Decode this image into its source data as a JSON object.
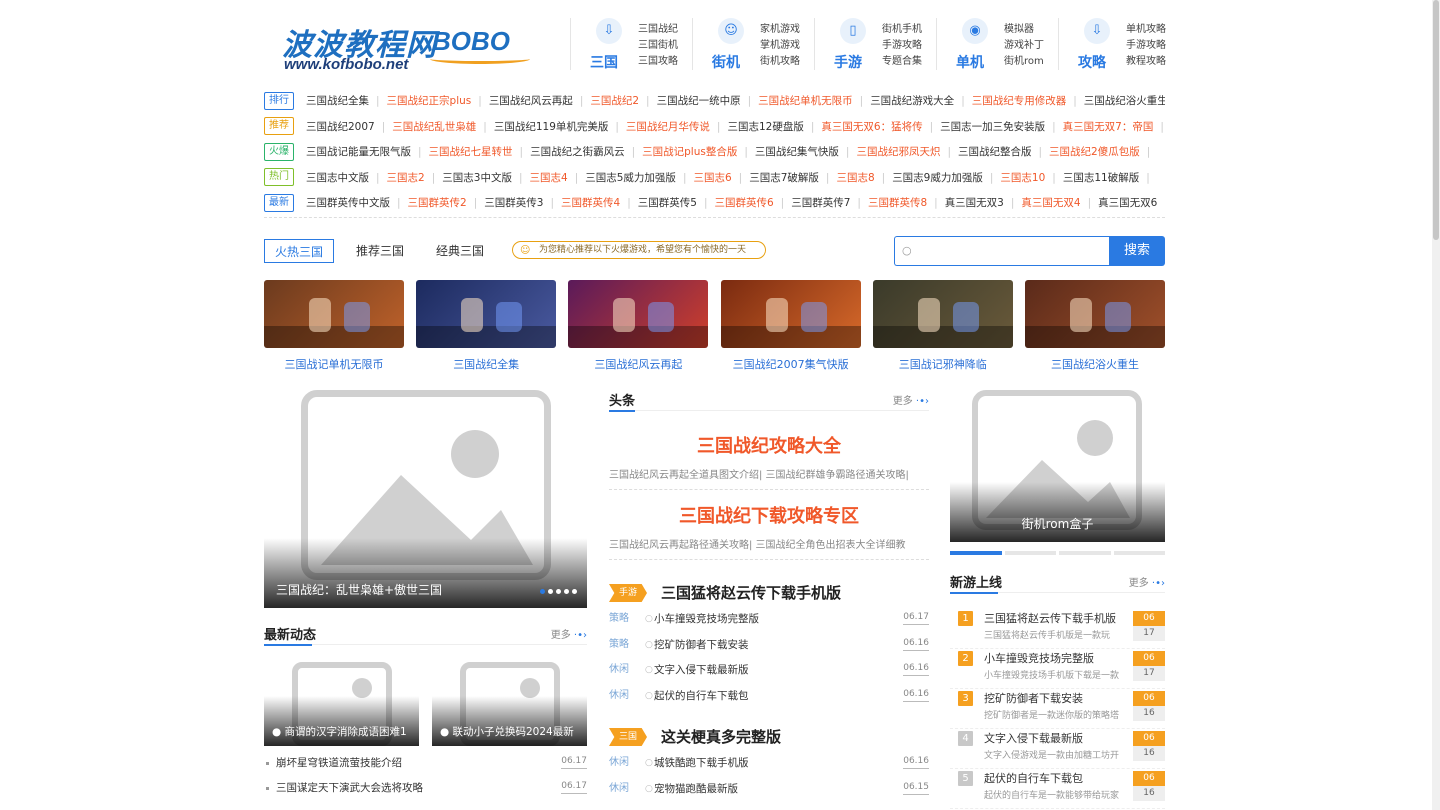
{
  "logo": {
    "cn": "波波教程网",
    "en": "BOBO",
    "url": "www.kofbobo.net"
  },
  "nav": [
    {
      "big": "三国",
      "icon": "download-icon",
      "subs": [
        "三国战纪",
        "三国街机",
        "三国攻略"
      ]
    },
    {
      "big": "街机",
      "icon": "user-icon",
      "subs": [
        "家机游戏",
        "掌机游戏",
        "街机攻略"
      ]
    },
    {
      "big": "手游",
      "icon": "phone-icon",
      "subs": [
        "街机手机",
        "手游攻略",
        "专题合集"
      ]
    },
    {
      "big": "单机",
      "icon": "gamepad-icon",
      "subs": [
        "模拟器",
        "游戏补丁",
        "街机rom"
      ]
    },
    {
      "big": "攻略",
      "icon": "download-icon",
      "subs": [
        "单机攻略",
        "手游攻略",
        "教程攻略"
      ]
    }
  ],
  "tag_rows": [
    {
      "badge": "排行",
      "items": [
        {
          "t": "三国战纪全集",
          "hot": false
        },
        {
          "t": "三国战纪正宗plus",
          "hot": true
        },
        {
          "t": "三国战纪风云再起",
          "hot": false
        },
        {
          "t": "三国战纪2",
          "hot": true
        },
        {
          "t": "三国战纪一统中原",
          "hot": false
        },
        {
          "t": "三国战纪单机无限币",
          "hot": true
        },
        {
          "t": "三国战纪游戏大全",
          "hot": false
        },
        {
          "t": "三国战纪专用修改器",
          "hot": true
        },
        {
          "t": "三国战纪浴火重生",
          "hot": false
        }
      ]
    },
    {
      "badge": "推荐",
      "items": [
        {
          "t": "三国战纪2007",
          "hot": false
        },
        {
          "t": "三国战纪乱世枭雄",
          "hot": true
        },
        {
          "t": "三国战纪119单机完美版",
          "hot": false
        },
        {
          "t": "三国战纪月华传说",
          "hot": true
        },
        {
          "t": "三国志12硬盘版",
          "hot": false
        },
        {
          "t": "真三国无双6：猛将传",
          "hot": true
        },
        {
          "t": "三国志一加三免安装版",
          "hot": false
        },
        {
          "t": "真三国无双7：帝国",
          "hot": true
        }
      ]
    },
    {
      "badge": "火爆",
      "items": [
        {
          "t": "三国战记能量无限气版",
          "hot": false
        },
        {
          "t": "三国战纪七星转世",
          "hot": true
        },
        {
          "t": "三国战纪之街霸风云",
          "hot": false
        },
        {
          "t": "三国战记plus整合版",
          "hot": true
        },
        {
          "t": "三国战纪集气快版",
          "hot": false
        },
        {
          "t": "三国战纪邪凤天炽",
          "hot": true
        },
        {
          "t": "三国战纪整合版",
          "hot": false
        },
        {
          "t": "三国战纪2傻瓜包版",
          "hot": true
        }
      ]
    },
    {
      "badge": "热门",
      "items": [
        {
          "t": "三国志中文版",
          "hot": false
        },
        {
          "t": "三国志2",
          "hot": true
        },
        {
          "t": "三国志3中文版",
          "hot": false
        },
        {
          "t": "三国志4",
          "hot": true
        },
        {
          "t": "三国志5威力加强版",
          "hot": false
        },
        {
          "t": "三国志6",
          "hot": true
        },
        {
          "t": "三国志7破解版",
          "hot": false
        },
        {
          "t": "三国志8",
          "hot": true
        },
        {
          "t": "三国志9威力加强版",
          "hot": false
        },
        {
          "t": "三国志10",
          "hot": true
        },
        {
          "t": "三国志11破解版",
          "hot": false
        }
      ]
    },
    {
      "badge": "最新",
      "items": [
        {
          "t": "三国群英传中文版",
          "hot": false
        },
        {
          "t": "三国群英传2",
          "hot": true
        },
        {
          "t": "三国群英传3",
          "hot": false
        },
        {
          "t": "三国群英传4",
          "hot": true
        },
        {
          "t": "三国群英传5",
          "hot": false
        },
        {
          "t": "三国群英传6",
          "hot": true
        },
        {
          "t": "三国群英传7",
          "hot": false
        },
        {
          "t": "三国群英传8",
          "hot": true
        },
        {
          "t": "真三国无双3",
          "hot": false
        },
        {
          "t": "真三国无双4",
          "hot": true
        },
        {
          "t": "真三国无双6",
          "hot": false
        }
      ]
    }
  ],
  "tabs": [
    "火热三国",
    "推荐三国",
    "经典三国"
  ],
  "notice": "为您精心推荐以下火爆游戏，希望您有个愉快的一天",
  "search": {
    "button": "搜索",
    "placeholder": ""
  },
  "cards": [
    {
      "label": "三国战记单机无限币",
      "c1": "#6b3a1e",
      "c2": "#c0622a"
    },
    {
      "label": "三国战纪全集",
      "c1": "#1c2a5e",
      "c2": "#4a5aa0"
    },
    {
      "label": "三国战纪风云再起",
      "c1": "#5a1a5a",
      "c2": "#d0402a"
    },
    {
      "label": "三国战纪2007集气快版",
      "c1": "#7a2a10",
      "c2": "#d86a2a"
    },
    {
      "label": "三国战记邪神降临",
      "c1": "#3a3a2a",
      "c2": "#6a5a3a"
    },
    {
      "label": "三国战纪浴火重生",
      "c1": "#5a2a1a",
      "c2": "#a0502a"
    }
  ],
  "big_slide": {
    "caption": "三国战纪：乱世枭雄+傲世三国"
  },
  "latest": {
    "title": "最新动态",
    "more": "更多",
    "thumbs": [
      "商谓的汉字消除成语困难1",
      "联动小子兑换码2024最新"
    ],
    "list": [
      {
        "t": "崩坏星穹铁道流萤技能介绍",
        "d": "06.17"
      },
      {
        "t": "三国谋定天下演武大会选将攻略",
        "d": "06.17"
      }
    ]
  },
  "headlines": {
    "title": "头条",
    "more": "更多",
    "h1": "三国战纪攻略大全",
    "s1": "三国战纪风云再起全道具图文介绍| 三国战纪群雄争霸路径通关攻略|",
    "h2": "三国战纪下载攻略专区",
    "s2": "三国战纪风云再起路径通关攻略| 三国战纪全角色出招表大全详细教"
  },
  "cat1": {
    "tag": "手游",
    "title": "三国猛将赵云传下载手机版",
    "rows": [
      {
        "k": "策略",
        "n": "小车撞毁竞技场完整版",
        "d": "06.17"
      },
      {
        "k": "策略",
        "n": "挖矿防御者下载安装",
        "d": "06.16"
      },
      {
        "k": "休闲",
        "n": "文字入侵下载最新版",
        "d": "06.16"
      },
      {
        "k": "休闲",
        "n": "起伏的自行车下载包",
        "d": "06.16"
      }
    ]
  },
  "cat2": {
    "tag": "三国",
    "title": "这关梗真多完整版",
    "rows": [
      {
        "k": "休闲",
        "n": "城铁酷跑下载手机版",
        "d": "06.16"
      },
      {
        "k": "休闲",
        "n": "宠物猫跑酷最新版",
        "d": "06.15"
      }
    ]
  },
  "right_slide": {
    "caption": "街机rom盒子"
  },
  "newgames": {
    "title": "新游上线",
    "more": "更多",
    "items": [
      {
        "n": "1",
        "t": "三国猛将赵云传下载手机版",
        "s": "三国猛将赵云传手机版是一款玩",
        "m": "06",
        "d": "17",
        "c": "#f5a020"
      },
      {
        "n": "2",
        "t": "小车撞毁竞技场完整版",
        "s": "小车撞毁竞技场手机版下载是一款",
        "m": "06",
        "d": "17",
        "c": "#f5a020"
      },
      {
        "n": "3",
        "t": "挖矿防御者下载安装",
        "s": "挖矿防御者是一款迷你版的策略塔",
        "m": "06",
        "d": "16",
        "c": "#f5a020"
      },
      {
        "n": "4",
        "t": "文字入侵下载最新版",
        "s": "文字入侵游戏是一款由加糖工坊开",
        "m": "06",
        "d": "16",
        "c": "#c8c8c8"
      },
      {
        "n": "5",
        "t": "起伏的自行车下载包",
        "s": "起伏的自行车是一款能够带给玩家",
        "m": "06",
        "d": "16",
        "c": "#c8c8c8"
      }
    ]
  }
}
